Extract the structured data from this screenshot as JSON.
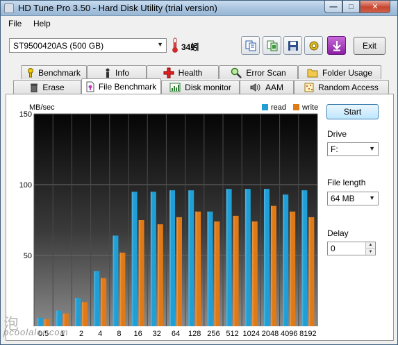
{
  "window": {
    "title": "HD Tune Pro 3.50 - Hard Disk Utility (trial version)",
    "minimize": "—",
    "maximize": "□",
    "close": "✕"
  },
  "menu": {
    "file": "File",
    "help": "Help"
  },
  "toolbar": {
    "drive": "ST9500420AS (500 GB)",
    "temperature": "34蚓",
    "exit": "Exit",
    "icons": [
      "copy-text-icon",
      "copy-screenshot-icon",
      "save-icon",
      "options-icon",
      "download-icon"
    ]
  },
  "tabs": {
    "row1": [
      "Benchmark",
      "Info",
      "Health",
      "Error Scan",
      "Folder Usage"
    ],
    "row2": [
      "Erase",
      "File Benchmark",
      "Disk monitor",
      "AAM",
      "Random Access"
    ],
    "active": "File Benchmark"
  },
  "side": {
    "start": "Start",
    "drive_label": "Drive",
    "drive_value": "F:",
    "file_length_label": "File length",
    "file_length_value": "64 MB",
    "delay_label": "Delay",
    "delay_value": "0"
  },
  "watermark": {
    "glyph": "泡",
    "text": "pcoolaler.com"
  },
  "chart_data": {
    "type": "bar",
    "ylabel": "MB/sec",
    "ylim": [
      0,
      150
    ],
    "y_ticks": [
      "150",
      "100",
      "50"
    ],
    "categories": [
      "0.5",
      "1",
      "2",
      "4",
      "8",
      "16",
      "32",
      "64",
      "128",
      "256",
      "512",
      "1024",
      "2048",
      "4096",
      "8192"
    ],
    "series": [
      {
        "name": "read",
        "color": "#1f9fd6",
        "values": [
          6,
          11,
          20,
          39,
          64,
          95,
          95,
          96,
          96,
          81,
          97,
          97,
          97,
          93,
          96
        ]
      },
      {
        "name": "write",
        "color": "#e07a16",
        "values": [
          5,
          9,
          17,
          34,
          52,
          75,
          72,
          77,
          81,
          74,
          78,
          74,
          85,
          81,
          77
        ]
      }
    ],
    "legend_position": "top-right",
    "grid": true
  }
}
